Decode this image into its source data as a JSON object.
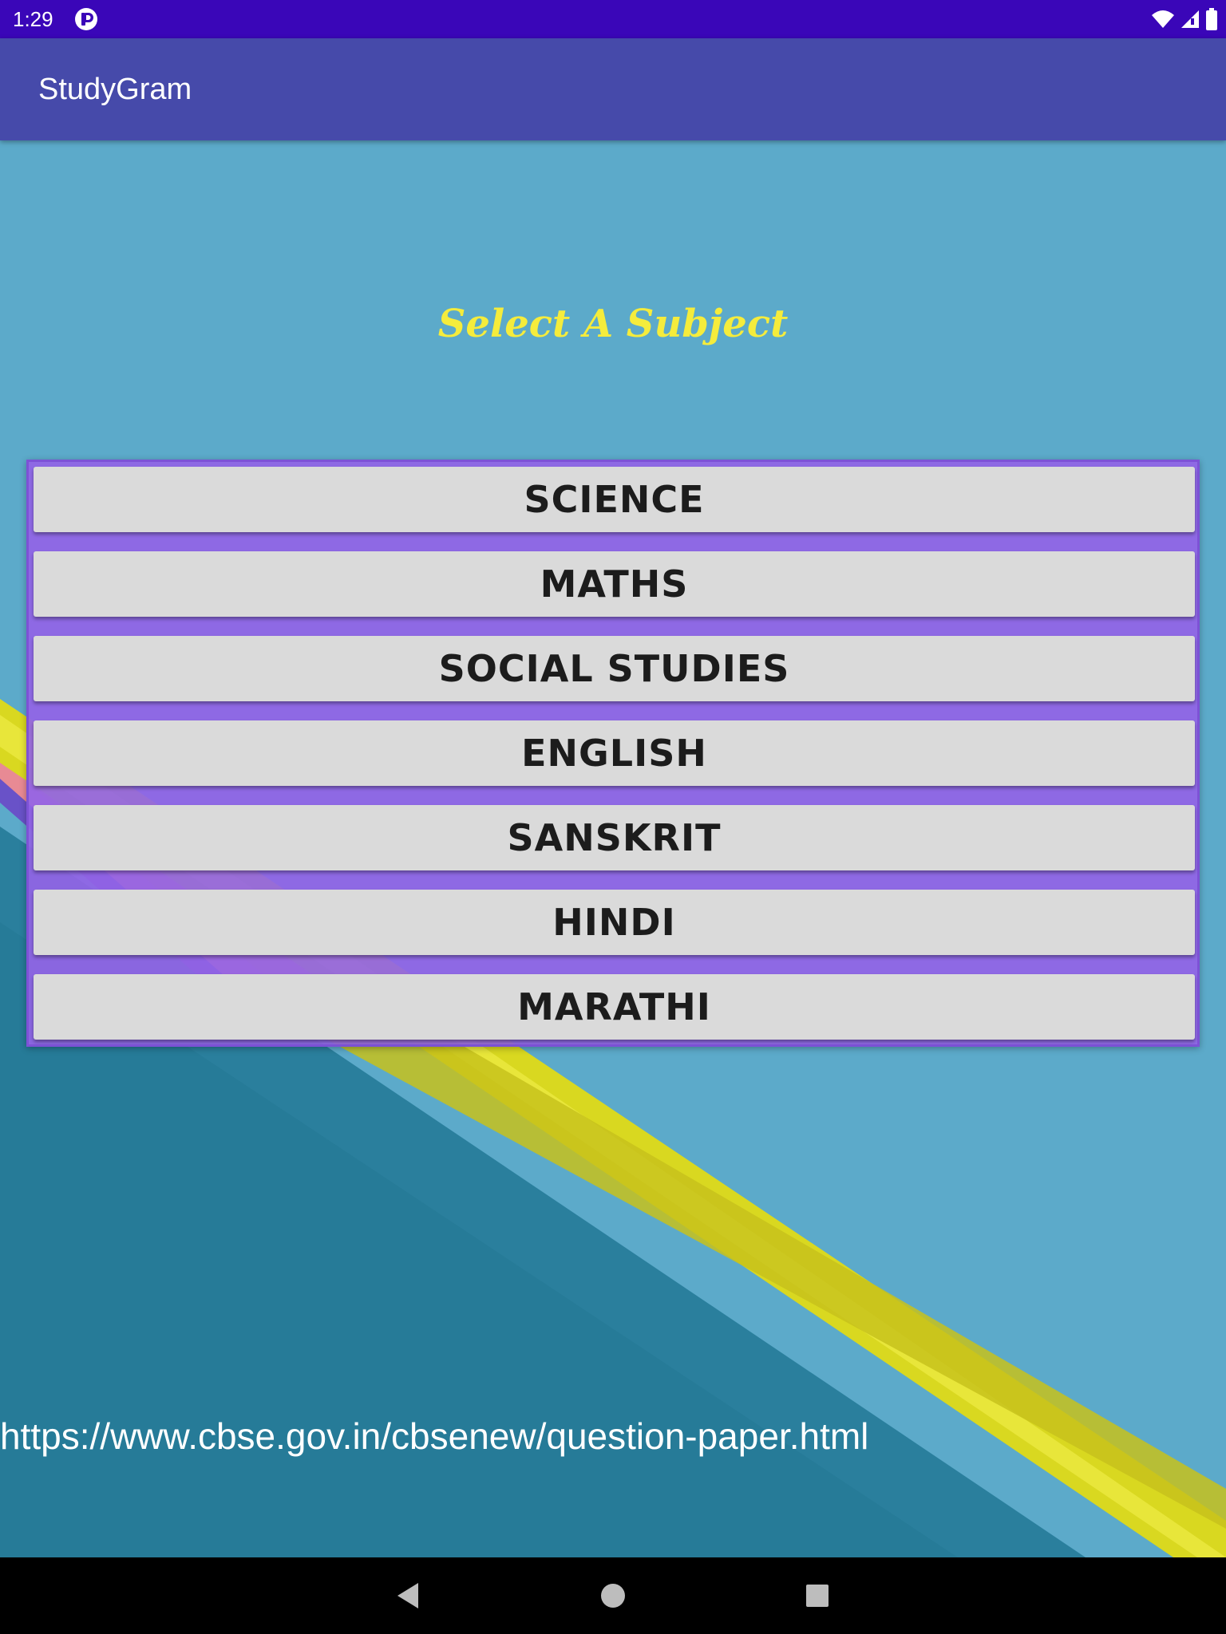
{
  "status_bar": {
    "time": "1:29",
    "background": "#3a06b8",
    "icons": [
      "app-notification-icon",
      "wifi-icon",
      "cell-signal-icon",
      "battery-icon"
    ]
  },
  "app_bar": {
    "title": "StudyGram",
    "background": "#464aaa"
  },
  "main": {
    "headline": "Select A Subject",
    "headline_color": "#f5ec3c",
    "subjects": [
      {
        "label": "SCIENCE"
      },
      {
        "label": "MATHS"
      },
      {
        "label": "SOCIAL STUDIES"
      },
      {
        "label": "ENGLISH"
      },
      {
        "label": "SANSKRIT"
      },
      {
        "label": "HINDI"
      },
      {
        "label": "MARATHI"
      }
    ],
    "panel_color": "#9264e6",
    "link_text": "https://www.cbse.gov.in/cbsenew/question-paper.html"
  },
  "nav_bar": {
    "buttons": [
      "back-icon",
      "home-icon",
      "recents-icon"
    ]
  }
}
